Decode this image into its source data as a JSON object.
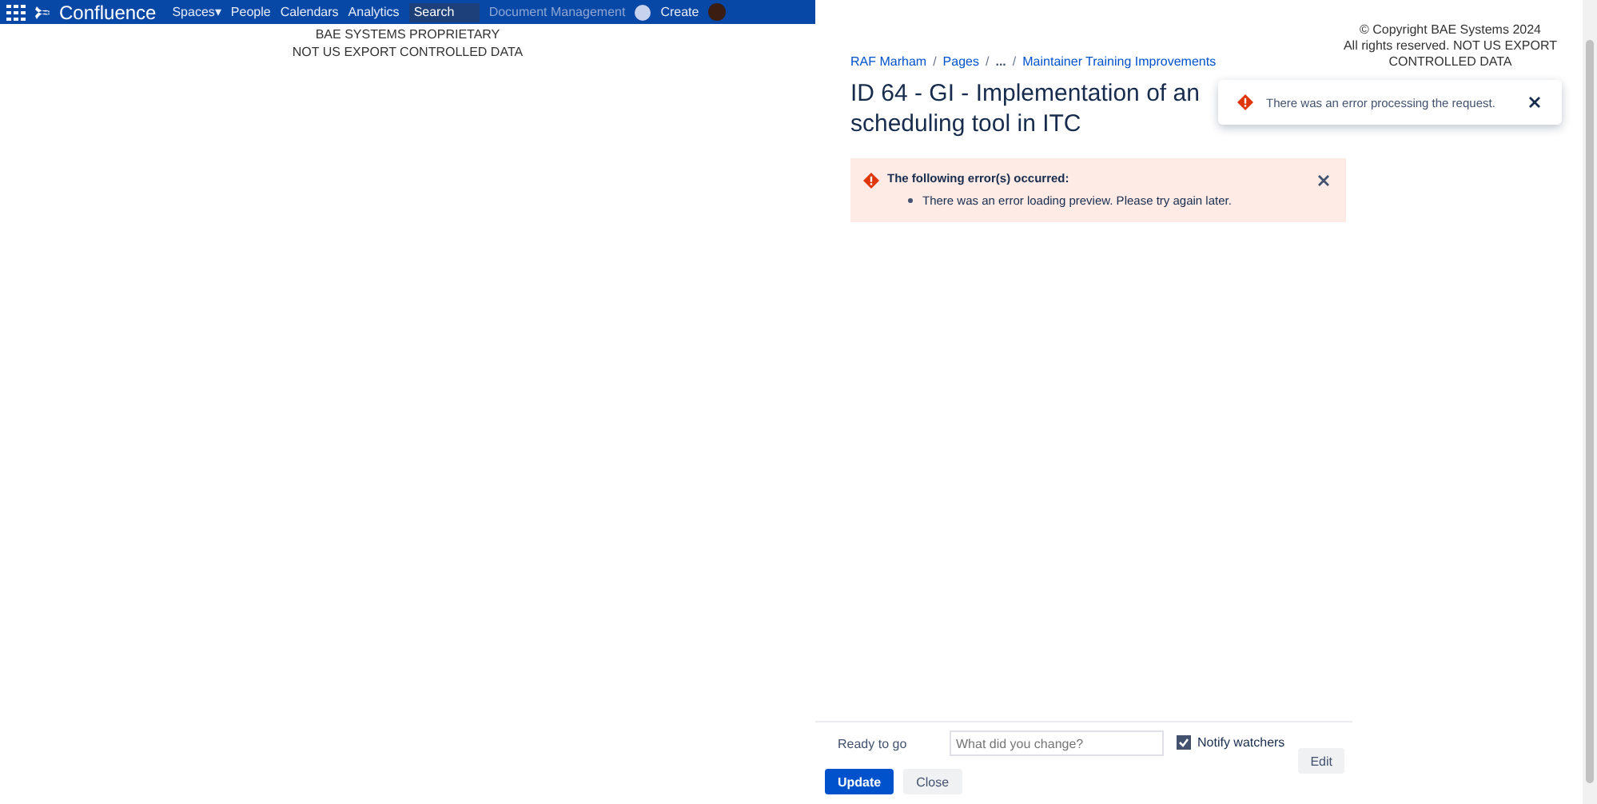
{
  "top_nav": {
    "logo": "Confluence",
    "caret": "▾",
    "items": [
      {
        "label": "Spaces",
        "caret": true
      },
      {
        "label": "People",
        "caret": false
      },
      {
        "label": "Calendars",
        "caret": false
      },
      {
        "label": "Analytics",
        "caret": false
      }
    ],
    "search": {
      "placeholder": "Search"
    },
    "links": [
      "Document Management"
    ],
    "create": "Create"
  },
  "banner": {
    "lines": [
      "BAE SYSTEMS PROPRIETARY",
      "NOT US EXPORT CONTROLLED DATA"
    ]
  },
  "copyright": {
    "lines": [
      "© Copyright BAE Systems 2024",
      "All rights reserved. NOT US EXPORT",
      "CONTROLLED DATA"
    ]
  },
  "breadcrumb_separator": "/",
  "breadcrumbs": [
    {
      "label": "RAF Marham",
      "kind": "link"
    },
    {
      "label": "Pages",
      "kind": "link"
    },
    {
      "label": "...",
      "kind": "ellipsis"
    },
    {
      "label": "Maintainer Training Improvements",
      "kind": "link"
    }
  ],
  "page_title": "ID 64 - GI - Implementation of an scheduling tool in ITC",
  "error_panel": {
    "heading": "The following error(s) occurred:",
    "items": [
      "There was an error loading preview. Please try again later."
    ]
  },
  "toast": {
    "message": "There was an error processing the request."
  },
  "editor_bar": {
    "status": "Ready to go",
    "comment": {
      "placeholder": "What did you change?"
    },
    "notify": {
      "label": "Notify watchers",
      "checked": true
    },
    "edit": "Edit",
    "update": "Update",
    "close": "Close"
  }
}
